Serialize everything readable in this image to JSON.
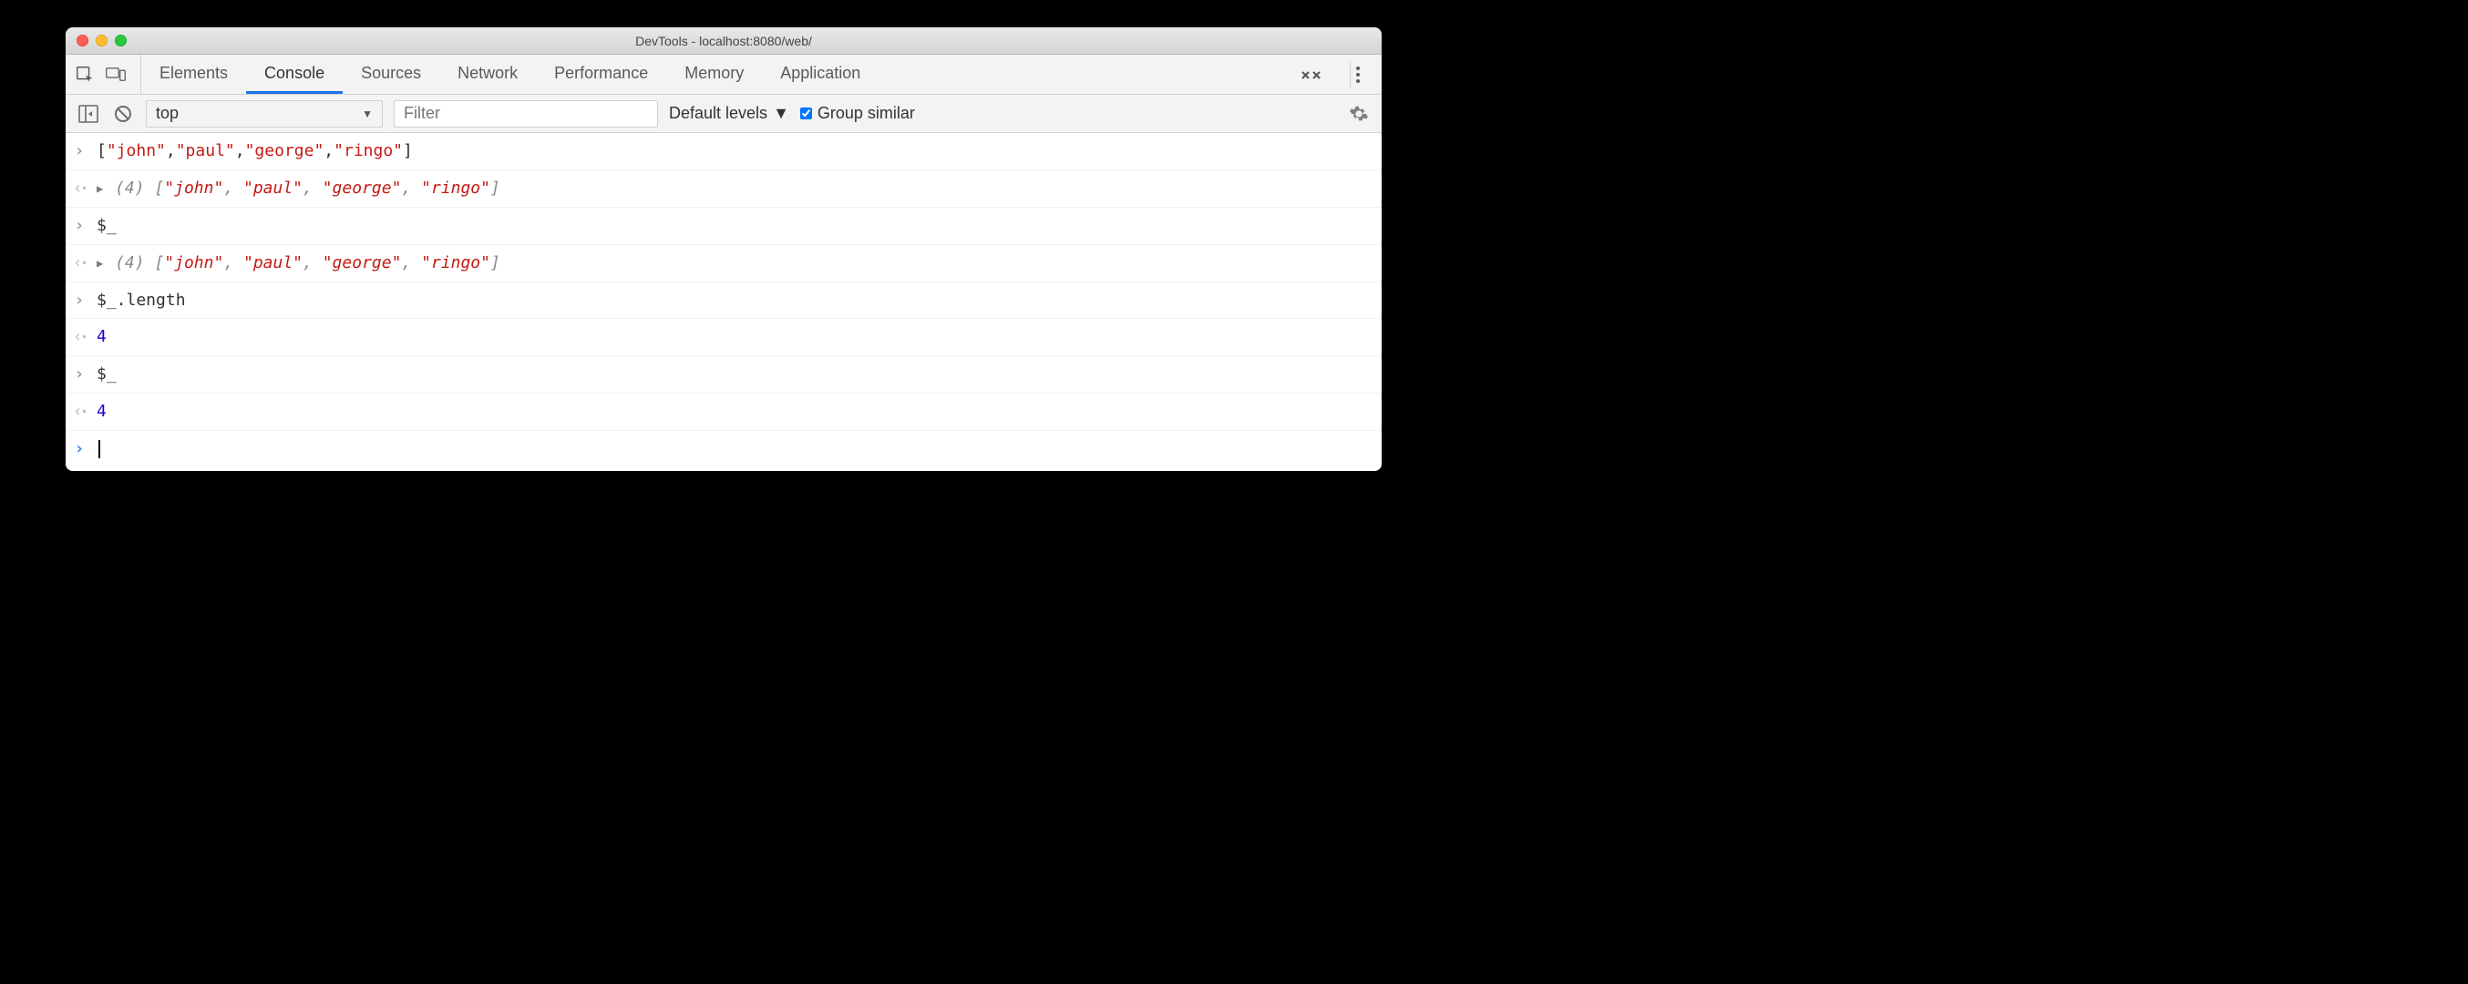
{
  "window": {
    "title": "DevTools - localhost:8080/web/"
  },
  "tabs": {
    "items": [
      "Elements",
      "Console",
      "Sources",
      "Network",
      "Performance",
      "Memory",
      "Application"
    ],
    "active": "Console"
  },
  "toolbar": {
    "context": "top",
    "filter_placeholder": "Filter",
    "levels_label": "Default levels",
    "group_similar_label": "Group similar",
    "group_similar_checked": true
  },
  "console": {
    "rows": [
      {
        "kind": "input",
        "tokens": [
          {
            "t": "[",
            "c": "plain"
          },
          {
            "t": "\"john\"",
            "c": "str"
          },
          {
            "t": ",",
            "c": "plain"
          },
          {
            "t": "\"paul\"",
            "c": "str"
          },
          {
            "t": ",",
            "c": "plain"
          },
          {
            "t": "\"george\"",
            "c": "str"
          },
          {
            "t": ",",
            "c": "plain"
          },
          {
            "t": "\"ringo\"",
            "c": "str"
          },
          {
            "t": "]",
            "c": "plain"
          }
        ]
      },
      {
        "kind": "output",
        "expandable": true,
        "italic": true,
        "tokens": [
          {
            "t": "(4) ",
            "c": "dim"
          },
          {
            "t": "[",
            "c": "dim"
          },
          {
            "t": "\"john\"",
            "c": "str"
          },
          {
            "t": ", ",
            "c": "dim"
          },
          {
            "t": "\"paul\"",
            "c": "str"
          },
          {
            "t": ", ",
            "c": "dim"
          },
          {
            "t": "\"george\"",
            "c": "str"
          },
          {
            "t": ", ",
            "c": "dim"
          },
          {
            "t": "\"ringo\"",
            "c": "str"
          },
          {
            "t": "]",
            "c": "dim"
          }
        ]
      },
      {
        "kind": "input",
        "tokens": [
          {
            "t": "$_",
            "c": "plain"
          }
        ]
      },
      {
        "kind": "output",
        "expandable": true,
        "italic": true,
        "tokens": [
          {
            "t": "(4) ",
            "c": "dim"
          },
          {
            "t": "[",
            "c": "dim"
          },
          {
            "t": "\"john\"",
            "c": "str"
          },
          {
            "t": ", ",
            "c": "dim"
          },
          {
            "t": "\"paul\"",
            "c": "str"
          },
          {
            "t": ", ",
            "c": "dim"
          },
          {
            "t": "\"george\"",
            "c": "str"
          },
          {
            "t": ", ",
            "c": "dim"
          },
          {
            "t": "\"ringo\"",
            "c": "str"
          },
          {
            "t": "]",
            "c": "dim"
          }
        ]
      },
      {
        "kind": "input",
        "tokens": [
          {
            "t": "$_.length",
            "c": "plain"
          }
        ]
      },
      {
        "kind": "output",
        "tokens": [
          {
            "t": "4",
            "c": "num"
          }
        ]
      },
      {
        "kind": "input",
        "tokens": [
          {
            "t": "$_",
            "c": "plain"
          }
        ]
      },
      {
        "kind": "output",
        "tokens": [
          {
            "t": "4",
            "c": "num"
          }
        ]
      }
    ]
  }
}
